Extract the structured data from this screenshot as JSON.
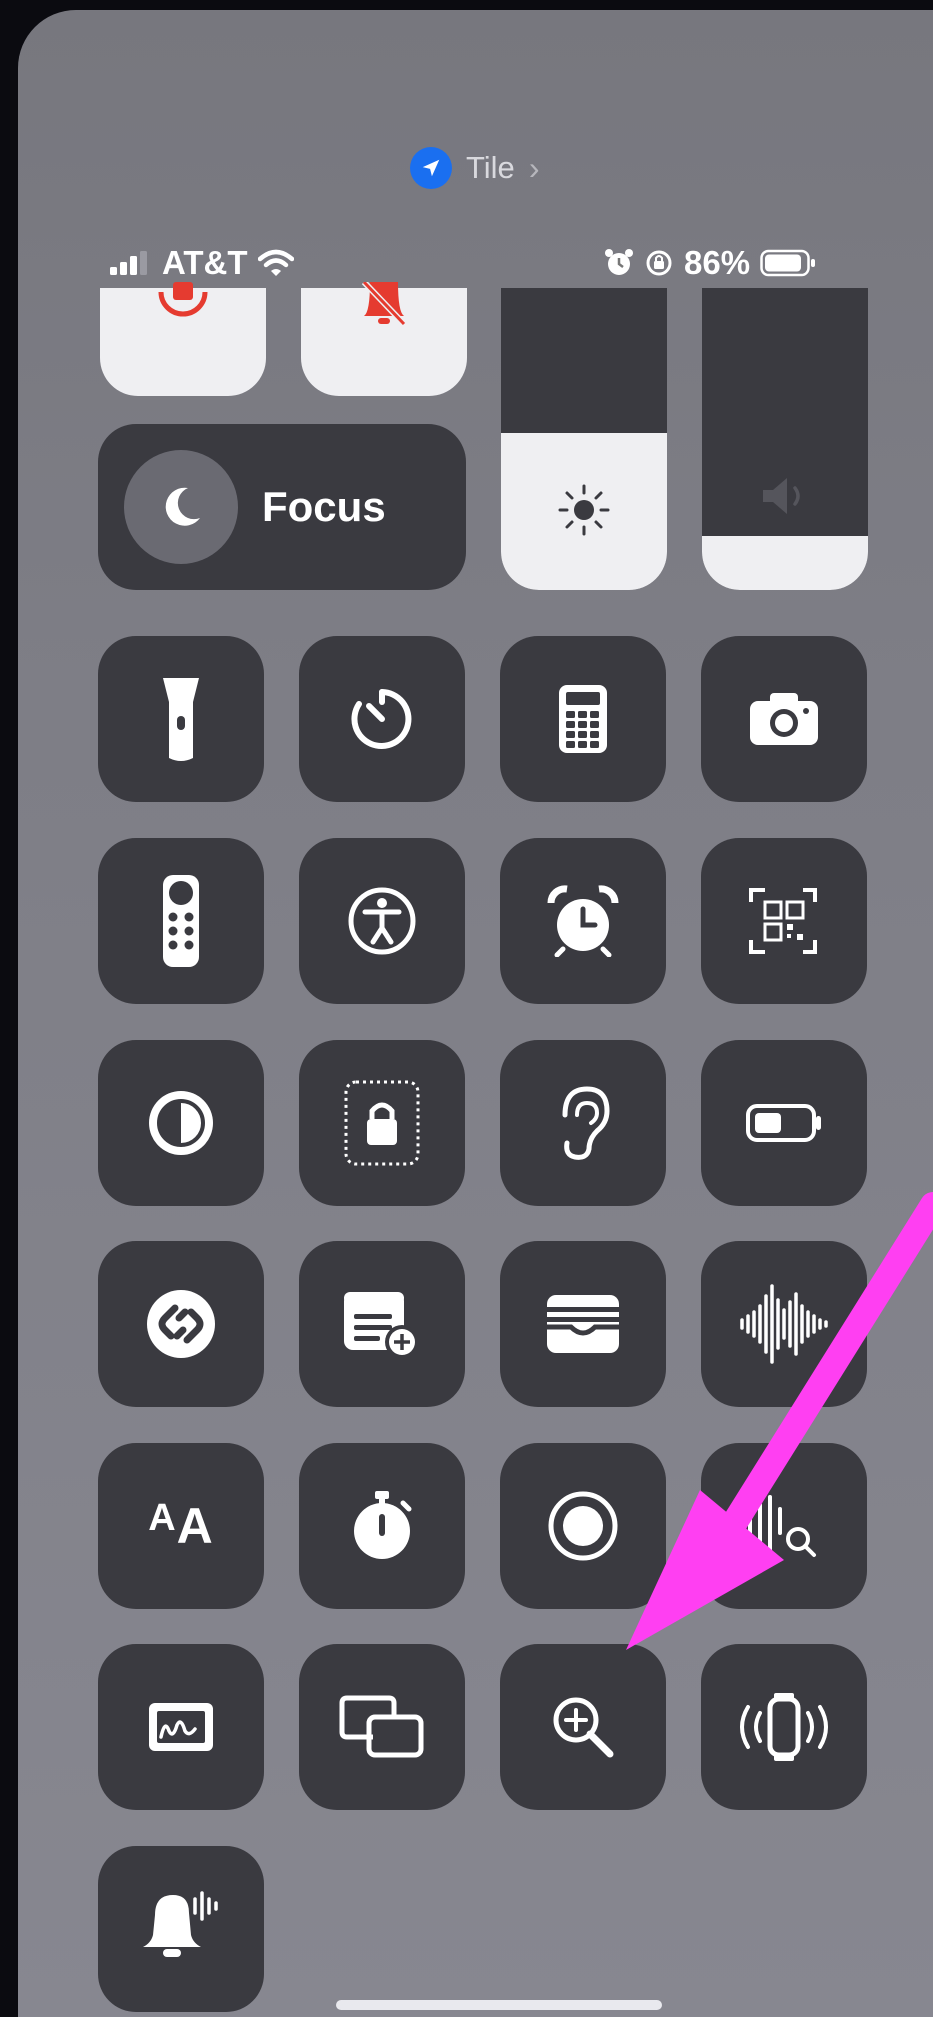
{
  "location_pill": {
    "label": "Tile",
    "chevron": "›",
    "icon": "location-arrow-icon",
    "accent": "#1a6ff0"
  },
  "status_bar": {
    "carrier": "AT&T",
    "battery_percent": "86%",
    "signal_icon": "signal-bars-icon",
    "wifi_icon": "wifi-icon",
    "alarm_icon": "alarm-icon",
    "orientation_lock_icon": "orientation-lock-icon"
  },
  "focus": {
    "label": "Focus",
    "icon": "moon-icon"
  },
  "brightness": {
    "level": 0.52,
    "icon": "sun-icon"
  },
  "volume": {
    "level": 0.18,
    "icon": "speaker-icon"
  },
  "top_partial_tiles": [
    {
      "name": "orientation-lock",
      "icon": "orientation-lock-icon",
      "color": "#e53b30"
    },
    {
      "name": "silent-mode",
      "icon": "bell-slash-icon",
      "color": "#e53b30"
    }
  ],
  "grid_tiles": [
    {
      "name": "flashlight",
      "icon": "flashlight-icon"
    },
    {
      "name": "timer",
      "icon": "timer-icon"
    },
    {
      "name": "calculator",
      "icon": "calculator-icon"
    },
    {
      "name": "camera",
      "icon": "camera-icon"
    },
    {
      "name": "apple-tv-remote",
      "icon": "remote-icon"
    },
    {
      "name": "accessibility-shortcuts",
      "icon": "accessibility-icon"
    },
    {
      "name": "alarm",
      "icon": "alarm-clock-icon"
    },
    {
      "name": "code-scanner",
      "icon": "qr-code-icon"
    },
    {
      "name": "dark-mode",
      "icon": "dark-mode-icon"
    },
    {
      "name": "guided-access",
      "icon": "guided-access-lock-icon"
    },
    {
      "name": "hearing",
      "icon": "ear-icon"
    },
    {
      "name": "low-power-mode",
      "icon": "battery-icon"
    },
    {
      "name": "shazam",
      "icon": "shazam-icon"
    },
    {
      "name": "quick-note",
      "icon": "quick-note-icon"
    },
    {
      "name": "wallet",
      "icon": "wallet-icon"
    },
    {
      "name": "voice-memos",
      "icon": "waveform-icon"
    },
    {
      "name": "text-size",
      "icon": "text-size-icon",
      "text": "AA"
    },
    {
      "name": "stopwatch",
      "icon": "stopwatch-icon"
    },
    {
      "name": "screen-recording",
      "icon": "record-icon"
    },
    {
      "name": "sound-recognition",
      "icon": "sound-recognition-icon"
    },
    {
      "name": "notes",
      "icon": "notes-sketch-icon"
    },
    {
      "name": "screen-mirroring",
      "icon": "screen-mirroring-icon"
    },
    {
      "name": "magnifier",
      "icon": "magnifier-plus-icon"
    },
    {
      "name": "ping-my-watch",
      "icon": "watch-ping-icon"
    },
    {
      "name": "announce-notifications",
      "icon": "bell-waveform-icon"
    }
  ],
  "annotation": {
    "color": "#ff3ff2",
    "icon": "pointer-arrow-icon"
  }
}
